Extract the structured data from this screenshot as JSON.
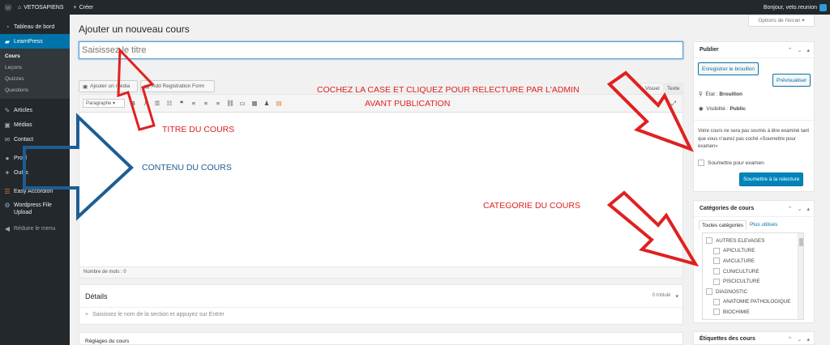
{
  "adminbar": {
    "wp_icon": "wordpress-icon",
    "site_name": "VETOSAPIENS",
    "new_label": "Créer",
    "howdy": "Bonjour, veto.reunion"
  },
  "sidebar": {
    "items": [
      {
        "label": "Tableau de bord",
        "icon": "dashboard-icon"
      },
      {
        "label": "LearnPress",
        "icon": "learnpress-icon"
      },
      {
        "label": "Articles",
        "icon": "pin-icon"
      },
      {
        "label": "Médias",
        "icon": "media-icon"
      },
      {
        "label": "Contact",
        "icon": "mail-icon"
      },
      {
        "label": "Profil",
        "icon": "user-icon"
      },
      {
        "label": "Outils",
        "icon": "wrench-icon"
      },
      {
        "label": "Easy Accordion",
        "icon": "accordion-icon"
      },
      {
        "label": "Wordpress File Upload",
        "icon": "gear-icon"
      },
      {
        "label": "Réduire le menu",
        "icon": "collapse-icon"
      }
    ],
    "submenu": [
      "Cours",
      "Leçons",
      "Quizzes",
      "Questions"
    ]
  },
  "screen_options": "Options de l'écran ▾",
  "page_title": "Ajouter un nouveau cours",
  "title_placeholder": "Saisissez le titre",
  "media_button": "Ajouter un média",
  "registration_button": "Add Registration Form",
  "tab_visual": "Visuel",
  "tab_text": "Texte",
  "format_select": "Paragraphe",
  "word_count": "Nombre de mots : 0",
  "details": {
    "title": "Détails",
    "count": "0 Intitulé",
    "add_section": "Saisissez le nom de la section et appuyez sur Entrer"
  },
  "course_settings": "Réglages du cours",
  "publish": {
    "title": "Publier",
    "save_draft": "Enregistrer le brouillon",
    "preview": "Prévisualiser",
    "status_label": "État :",
    "status_value": "Brouillon",
    "visibility_label": "Visibilité :",
    "visibility_value": "Public",
    "notice": "Votre cours ne sera pas soumis à être examiné tant que vous n'aurez pas coché «Soumettre pour examen»",
    "submit_check": "Soumettre pour examen",
    "submit_button": "Soumettre à la relecture"
  },
  "categories": {
    "title": "Catégories de cours",
    "tab_all": "Toutes catégories",
    "tab_popular": "Plus utilisés",
    "items": [
      {
        "label": "AUTRES ELEVAGES",
        "level": 0
      },
      {
        "label": "APICULTURE",
        "level": 1
      },
      {
        "label": "AVICULTURE",
        "level": 1
      },
      {
        "label": "CUNICULTURE",
        "level": 1
      },
      {
        "label": "PISCICULTURE",
        "level": 1
      },
      {
        "label": "DIAGNOSTIC",
        "level": 0
      },
      {
        "label": "ANATOMIE PATHOLOGIQUE",
        "level": 1
      },
      {
        "label": "BIOCHIMIE",
        "level": 1
      }
    ]
  },
  "tags_box_title": "Étiquettes des cours",
  "annotations": {
    "check_line1": "COCHEZ LA CASE ET CLIQUEZ POUR RELECTURE PAR L'ADMIN",
    "check_line2": "AVANT PUBLICATION",
    "title_label": "TITRE DU COURS",
    "content_label": "CONTENU DU COURS",
    "category_label": "CATEGORIE DU COURS"
  },
  "colors": {
    "wp_blue": "#0073aa",
    "admin_dark": "#23282d",
    "annotation_red": "#e02020",
    "annotation_blue": "#1d5d94"
  }
}
